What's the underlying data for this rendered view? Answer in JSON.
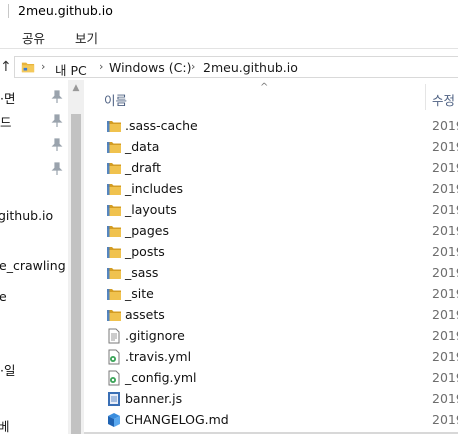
{
  "window": {
    "title": "2meu.github.io"
  },
  "ribbon": {
    "tabs": [
      "공유",
      "보기"
    ]
  },
  "address": {
    "up_glyph": "↑",
    "chevron": "›",
    "crumbs": [
      "내 PC",
      "Windows (C:)",
      "2meu.github.io"
    ]
  },
  "nav": {
    "items": [
      "·면",
      "드",
      "",
      "",
      "github.io",
      "e_crawling",
      "e",
      "",
      "·일",
      "베"
    ]
  },
  "columns": {
    "name": "이름",
    "date": "수정",
    "sort_glyph": "^"
  },
  "files": [
    {
      "name": ".sass-cache",
      "type": "folder",
      "date": "2019"
    },
    {
      "name": "_data",
      "type": "folder",
      "date": "2019"
    },
    {
      "name": "_draft",
      "type": "folder",
      "date": "2019"
    },
    {
      "name": "_includes",
      "type": "folder",
      "date": "2019"
    },
    {
      "name": "_layouts",
      "type": "folder",
      "date": "2019"
    },
    {
      "name": "_pages",
      "type": "folder",
      "date": "2019"
    },
    {
      "name": "_posts",
      "type": "folder",
      "date": "2019"
    },
    {
      "name": "_sass",
      "type": "folder",
      "date": "2019"
    },
    {
      "name": "_site",
      "type": "folder",
      "date": "2019"
    },
    {
      "name": "assets",
      "type": "folder",
      "date": "2019"
    },
    {
      "name": ".gitignore",
      "type": "text-file",
      "date": "2019"
    },
    {
      "name": ".travis.yml",
      "type": "yml-file",
      "date": "2019"
    },
    {
      "name": "_config.yml",
      "type": "yml-file",
      "date": "2019"
    },
    {
      "name": "banner.js",
      "type": "js-file",
      "date": "2019"
    },
    {
      "name": "CHANGELOG.md",
      "type": "md-file",
      "date": "2019"
    }
  ],
  "colors": {
    "folder": "#e8b43c",
    "folder_dark": "#d49d23",
    "header_text": "#4d6082",
    "date_text": "#6d6d6d",
    "pin": "#9aa3ad"
  }
}
